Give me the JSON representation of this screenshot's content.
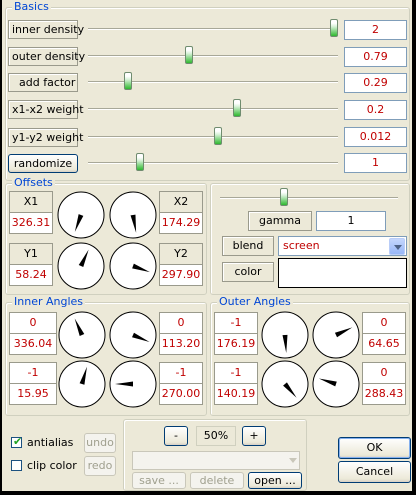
{
  "basics": {
    "title": "Basics",
    "rows": [
      {
        "label": "inner density",
        "value": "2",
        "fraction": 1.0
      },
      {
        "label": "outer density",
        "value": "0.79",
        "fraction": 0.4
      },
      {
        "label": "add factor",
        "value": "0.29",
        "fraction": 0.15
      },
      {
        "label": "x1-x2 weight",
        "value": "0.2",
        "fraction": 0.6
      },
      {
        "label": "y1-y2 weight",
        "value": "0.012",
        "fraction": 0.52
      }
    ],
    "randomize_label": "randomize",
    "randomize_value": "1",
    "randomize_fraction": 0.2
  },
  "offsets": {
    "title": "Offsets",
    "x1_label": "X1",
    "x1_value": "326.31",
    "y1_label": "Y1",
    "y1_value": "58.24",
    "x2_label": "X2",
    "x2_value": "174.29",
    "y2_label": "Y2",
    "y2_value": "297.90",
    "dials": [
      200,
      170,
      25,
      110
    ]
  },
  "gamma": {
    "label": "gamma",
    "value": "1",
    "fraction": 0.35,
    "blend_label": "blend",
    "blend_value": "screen",
    "color_label": "color",
    "color_value": "#ffffff"
  },
  "inner_angles": {
    "title": "Inner Angles",
    "tl_top": "0",
    "tl_bot": "336.04",
    "tr_top": "0",
    "tr_bot": "113.20",
    "bl_top": "-1",
    "bl_bot": "15.95",
    "br_top": "-1",
    "br_bot": "270.00",
    "dials": [
      336,
      113,
      16,
      270
    ]
  },
  "outer_angles": {
    "title": "Outer Angles",
    "tl_top": "-1",
    "tl_bot": "176.19",
    "tr_top": "0",
    "tr_bot": "64.65",
    "bl_top": "-1",
    "bl_bot": "140.19",
    "br_top": "0",
    "br_bot": "288.43",
    "dials": [
      176,
      65,
      140,
      288
    ]
  },
  "bottom": {
    "antialias_label": "antialias",
    "antialias_checked": true,
    "clip_color_label": "clip color",
    "clip_color_checked": false,
    "undo_label": "undo",
    "redo_label": "redo",
    "zoom_minus": "-",
    "zoom_value": "50%",
    "zoom_plus": "+",
    "save_label": "save ...",
    "delete_label": "delete",
    "open_label": "open ...",
    "ok_label": "OK",
    "cancel_label": "Cancel"
  },
  "colors": {
    "value_text": "#c00000",
    "group_title": "#0046d5",
    "thumb": "#2eb82e"
  }
}
